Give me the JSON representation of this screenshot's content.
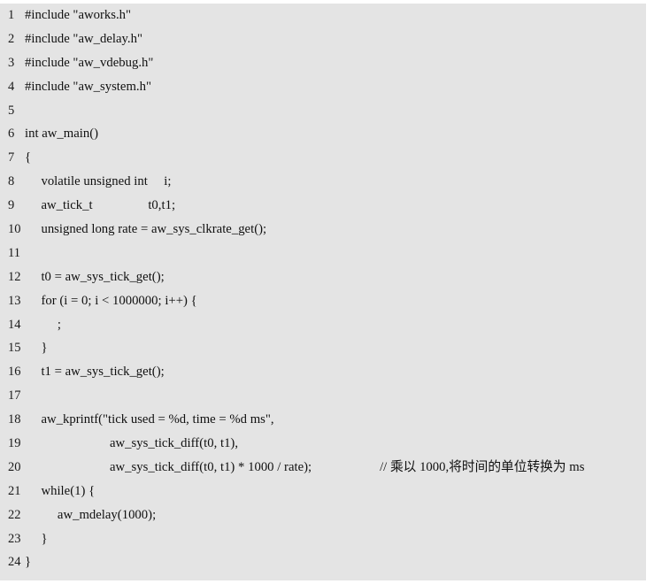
{
  "code_block": {
    "language": "c",
    "background_color": "#e4e4e4",
    "text_color": "#101010",
    "line_number_color": "#1a1a1a",
    "total_lines": 24,
    "lines": [
      {
        "number": "1",
        "code": "#include \"aworks.h\""
      },
      {
        "number": "2",
        "code": "#include \"aw_delay.h\""
      },
      {
        "number": "3",
        "code": "#include \"aw_vdebug.h\""
      },
      {
        "number": "4",
        "code": "#include \"aw_system.h\""
      },
      {
        "number": "5",
        "code": ""
      },
      {
        "number": "6",
        "code": "int aw_main()"
      },
      {
        "number": "7",
        "code": "{"
      },
      {
        "number": "8",
        "code": "     volatile unsigned int     i;"
      },
      {
        "number": "9",
        "code": "     aw_tick_t                 t0,t1;"
      },
      {
        "number": "10",
        "code": "     unsigned long rate = aw_sys_clkrate_get();"
      },
      {
        "number": "11",
        "code": ""
      },
      {
        "number": "12",
        "code": "     t0 = aw_sys_tick_get();"
      },
      {
        "number": "13",
        "code": "     for (i = 0; i < 1000000; i++) {"
      },
      {
        "number": "14",
        "code": "          ;"
      },
      {
        "number": "15",
        "code": "     }"
      },
      {
        "number": "16",
        "code": "     t1 = aw_sys_tick_get();"
      },
      {
        "number": "17",
        "code": ""
      },
      {
        "number": "18",
        "code": "     aw_kprintf(\"tick used = %d, time = %d ms\","
      },
      {
        "number": "19",
        "code": "                          aw_sys_tick_diff(t0, t1),"
      },
      {
        "number": "20",
        "code": "                          aw_sys_tick_diff(t0, t1) * 1000 / rate);  ",
        "comment": "// 乘以 1000,将时间的单位转换为 ms"
      },
      {
        "number": "21",
        "code": "     while(1) {"
      },
      {
        "number": "22",
        "code": "          aw_mdelay(1000);"
      },
      {
        "number": "23",
        "code": "     }"
      },
      {
        "number": "24",
        "code": "}"
      }
    ]
  }
}
